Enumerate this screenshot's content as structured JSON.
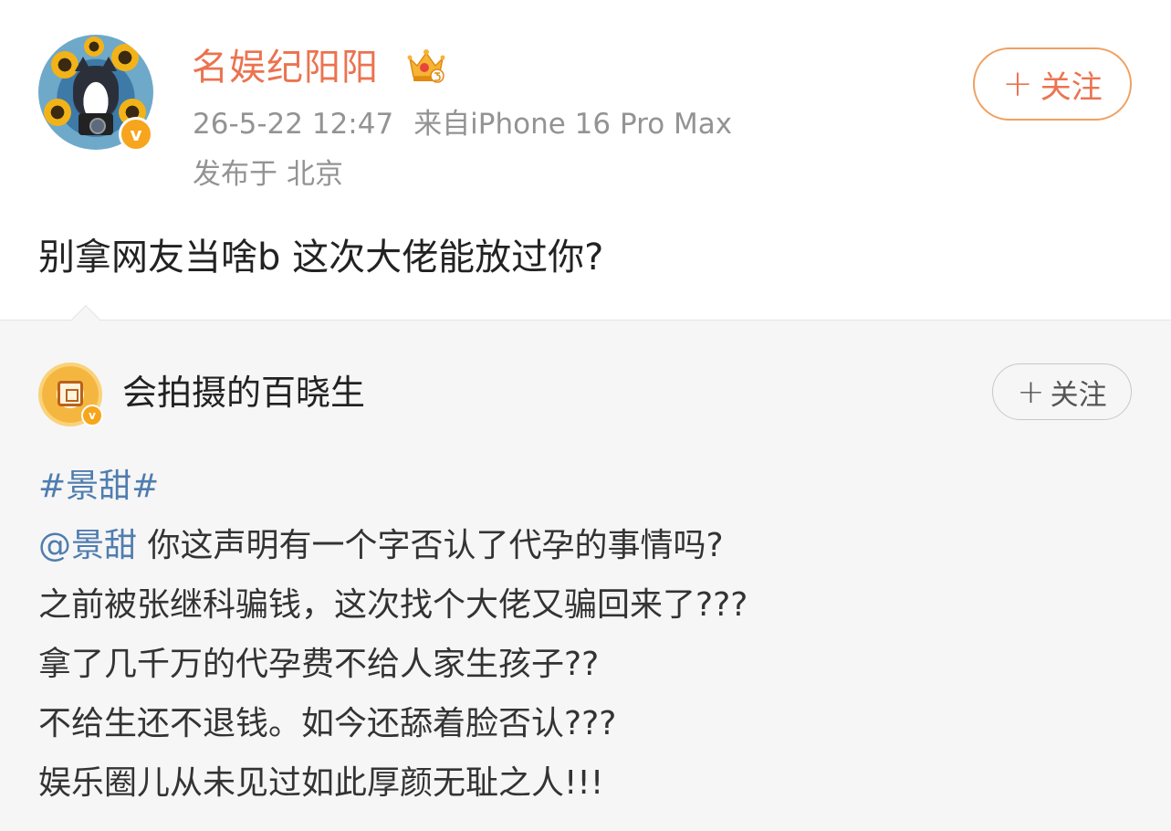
{
  "post": {
    "author": "名娱纪阳阳",
    "timestamp": "26-5-22 12:47",
    "source": "来自iPhone 16 Pro Max",
    "location_prefix": "发布于",
    "location": "北京",
    "follow_label": "关注",
    "follow_plus": "+",
    "text": "别拿网友当啥b 这次大佬能放过你?"
  },
  "repost": {
    "author": "会拍摄的百晓生",
    "follow_label": "关注",
    "follow_plus": "+",
    "hashtag": "#景甜#",
    "mention": "@景甜",
    "line1_rest": " 你这声明有一个字否认了代孕的事情吗?",
    "lines": [
      "之前被张继科骗钱，这次找个大佬又骗回来了???",
      "拿了几千万的代孕费不给人家生孩子??",
      "不给生还不退钱。如今还舔着脸否认???",
      "娱乐圈儿从未见过如此厚颜无耻之人!!!"
    ]
  },
  "badges": {
    "verified": "v"
  },
  "colors": {
    "name_orange": "#eb7350",
    "link_blue": "#507daf",
    "meta_gray": "#939393"
  },
  "icons": [
    "crown-vip-icon",
    "verified-badge-icon",
    "plus-icon"
  ]
}
